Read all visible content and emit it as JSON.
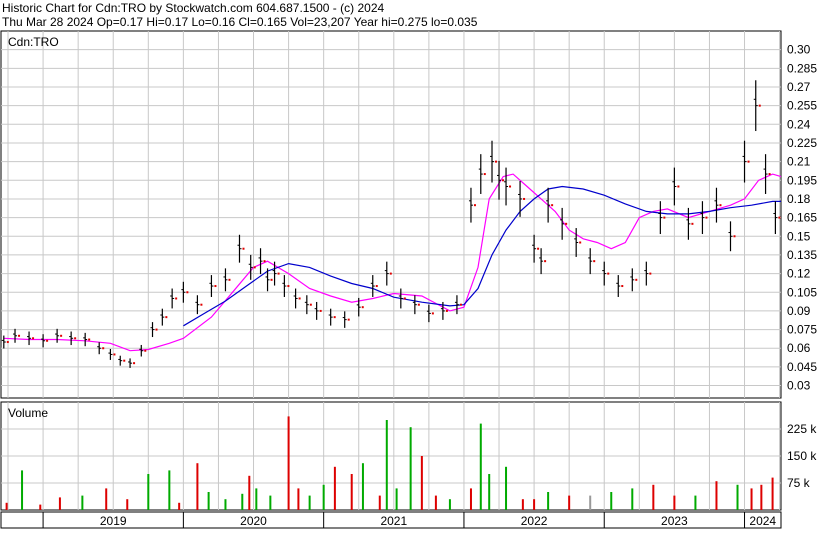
{
  "header": {
    "line1": "Historic Chart for Cdn:TRO by Stockwatch.com 604.687.1500 - (c) 2024",
    "line2": "Thu Mar 28 2024   Op=0.17   Hi=0.17   Lo=0.16   Cl=0.165   Vol=23,207   Year hi=0.275   lo=0.035"
  },
  "chart_data": [
    {
      "type": "ohlc",
      "title": "Cdn:TRO",
      "y_ticks": [
        "0.30",
        "0.285",
        "0.27",
        "0.255",
        "0.24",
        "0.225",
        "0.21",
        "0.195",
        "0.18",
        "0.165",
        "0.15",
        "0.135",
        "0.12",
        "0.105",
        "0.09",
        "0.075",
        "0.06",
        "0.045",
        "0.03"
      ],
      "ylim": [
        0.02,
        0.315
      ],
      "x_tick_labels": [
        "2019",
        "2020",
        "2021",
        "2022",
        "2023",
        "2024"
      ],
      "x_year_starts": [
        2019.0,
        2020.0,
        2021.0,
        2022.0,
        2023.0,
        2024.0
      ],
      "xlim": [
        2018.7,
        2024.26
      ],
      "grid": true,
      "colors": {
        "price_bar": "#000000",
        "flat_day": "#e00000",
        "ma_short": "#ff00ff",
        "ma_long": "#0000cc",
        "grid": "#c8c8c8"
      },
      "series": [
        {
          "name": "",
          "kind": "price",
          "x": [
            2018.72,
            2018.8,
            2018.9,
            2019.0,
            2019.1,
            2019.2,
            2019.3,
            2019.4,
            2019.48,
            2019.55,
            2019.62,
            2019.7,
            2019.78,
            2019.85,
            2019.92,
            2020.0,
            2020.1,
            2020.2,
            2020.3,
            2020.4,
            2020.48,
            2020.55,
            2020.6,
            2020.65,
            2020.72,
            2020.8,
            2020.88,
            2020.95,
            2021.05,
            2021.15,
            2021.25,
            2021.35,
            2021.45,
            2021.55,
            2021.65,
            2021.75,
            2021.85,
            2021.95,
            2022.05,
            2022.12,
            2022.2,
            2022.25,
            2022.3,
            2022.4,
            2022.5,
            2022.55,
            2022.6,
            2022.7,
            2022.8,
            2022.9,
            2023.0,
            2023.1,
            2023.2,
            2023.3,
            2023.4,
            2023.5,
            2023.6,
            2023.7,
            2023.8,
            2023.9,
            2024.0,
            2024.08,
            2024.15,
            2024.22
          ],
          "y": [
            0.065,
            0.07,
            0.068,
            0.066,
            0.07,
            0.068,
            0.067,
            0.06,
            0.055,
            0.05,
            0.048,
            0.058,
            0.075,
            0.085,
            0.1,
            0.105,
            0.095,
            0.11,
            0.115,
            0.14,
            0.125,
            0.13,
            0.115,
            0.12,
            0.11,
            0.1,
            0.095,
            0.09,
            0.085,
            0.083,
            0.093,
            0.11,
            0.12,
            0.1,
            0.095,
            0.088,
            0.09,
            0.095,
            0.175,
            0.2,
            0.21,
            0.195,
            0.19,
            0.18,
            0.14,
            0.13,
            0.175,
            0.16,
            0.145,
            0.13,
            0.12,
            0.11,
            0.115,
            0.12,
            0.165,
            0.19,
            0.16,
            0.165,
            0.175,
            0.15,
            0.21,
            0.255,
            0.2,
            0.165
          ]
        },
        {
          "name": "",
          "kind": "moving-average-short",
          "x": [
            2018.72,
            2018.9,
            2019.1,
            2019.3,
            2019.48,
            2019.62,
            2019.75,
            2019.9,
            2020.0,
            2020.2,
            2020.35,
            2020.5,
            2020.6,
            2020.75,
            2020.9,
            2021.05,
            2021.2,
            2021.35,
            2021.5,
            2021.7,
            2021.9,
            2022.0,
            2022.1,
            2022.18,
            2022.28,
            2022.35,
            2022.45,
            2022.55,
            2022.65,
            2022.75,
            2022.85,
            2022.95,
            2023.05,
            2023.15,
            2023.25,
            2023.35,
            2023.45,
            2023.6,
            2023.75,
            2023.9,
            2024.0,
            2024.1,
            2024.2,
            2024.26
          ],
          "y": [
            0.068,
            0.067,
            0.067,
            0.066,
            0.064,
            0.058,
            0.059,
            0.064,
            0.068,
            0.085,
            0.105,
            0.125,
            0.13,
            0.12,
            0.108,
            0.102,
            0.097,
            0.1,
            0.104,
            0.102,
            0.09,
            0.093,
            0.125,
            0.18,
            0.198,
            0.2,
            0.19,
            0.18,
            0.17,
            0.155,
            0.148,
            0.145,
            0.14,
            0.145,
            0.165,
            0.17,
            0.172,
            0.165,
            0.17,
            0.175,
            0.18,
            0.195,
            0.2,
            0.198
          ]
        },
        {
          "name": "",
          "kind": "moving-average-long",
          "x": [
            2020.0,
            2020.15,
            2020.3,
            2020.45,
            2020.6,
            2020.75,
            2020.9,
            2021.05,
            2021.2,
            2021.35,
            2021.5,
            2021.7,
            2021.9,
            2022.0,
            2022.1,
            2022.2,
            2022.3,
            2022.4,
            2022.5,
            2022.6,
            2022.7,
            2022.85,
            2023.0,
            2023.15,
            2023.3,
            2023.45,
            2023.6,
            2023.75,
            2023.9,
            2024.05,
            2024.2,
            2024.26
          ],
          "y": [
            0.078,
            0.088,
            0.098,
            0.11,
            0.122,
            0.128,
            0.125,
            0.118,
            0.112,
            0.108,
            0.101,
            0.097,
            0.094,
            0.095,
            0.108,
            0.135,
            0.155,
            0.17,
            0.18,
            0.188,
            0.19,
            0.188,
            0.183,
            0.176,
            0.17,
            0.168,
            0.168,
            0.17,
            0.173,
            0.175,
            0.178,
            0.178
          ]
        }
      ]
    },
    {
      "type": "bar",
      "title": "Volume",
      "y_ticks": [
        "225 k",
        "150 k",
        "75 k"
      ],
      "ylim": [
        0,
        300000
      ],
      "colors": {
        "up": "#00aa00",
        "down": "#dd0000",
        "flat": "#999999"
      },
      "series": [
        {
          "name": "",
          "x": [
            2018.74,
            2018.85,
            2018.98,
            2019.12,
            2019.28,
            2019.45,
            2019.6,
            2019.75,
            2019.9,
            2019.97,
            2020.1,
            2020.18,
            2020.3,
            2020.42,
            2020.47,
            2020.52,
            2020.62,
            2020.75,
            2020.82,
            2020.9,
            2021.0,
            2021.08,
            2021.2,
            2021.28,
            2021.4,
            2021.45,
            2021.52,
            2021.62,
            2021.7,
            2021.8,
            2021.9,
            2022.05,
            2022.12,
            2022.18,
            2022.3,
            2022.42,
            2022.5,
            2022.6,
            2022.75,
            2022.9,
            2023.05,
            2023.2,
            2023.35,
            2023.5,
            2023.65,
            2023.8,
            2023.95,
            2024.05,
            2024.12,
            2024.2
          ],
          "values": [
            20000,
            110000,
            15000,
            35000,
            40000,
            60000,
            30000,
            100000,
            110000,
            20000,
            130000,
            50000,
            30000,
            45000,
            95000,
            60000,
            40000,
            260000,
            60000,
            40000,
            70000,
            120000,
            100000,
            130000,
            40000,
            250000,
            60000,
            230000,
            150000,
            40000,
            30000,
            60000,
            240000,
            100000,
            120000,
            30000,
            30000,
            50000,
            40000,
            40000,
            50000,
            60000,
            70000,
            40000,
            40000,
            80000,
            70000,
            60000,
            70000,
            90000
          ],
          "dir": [
            "down",
            "up",
            "down",
            "down",
            "up",
            "down",
            "down",
            "up",
            "up",
            "down",
            "down",
            "up",
            "up",
            "up",
            "down",
            "up",
            "up",
            "down",
            "down",
            "up",
            "up",
            "down",
            "down",
            "up",
            "down",
            "up",
            "up",
            "up",
            "down",
            "down",
            "up",
            "down",
            "up",
            "up",
            "up",
            "down",
            "down",
            "up",
            "down",
            "flat",
            "up",
            "up",
            "down",
            "down",
            "up",
            "down",
            "up",
            "down",
            "down",
            "down"
          ]
        }
      ]
    }
  ]
}
